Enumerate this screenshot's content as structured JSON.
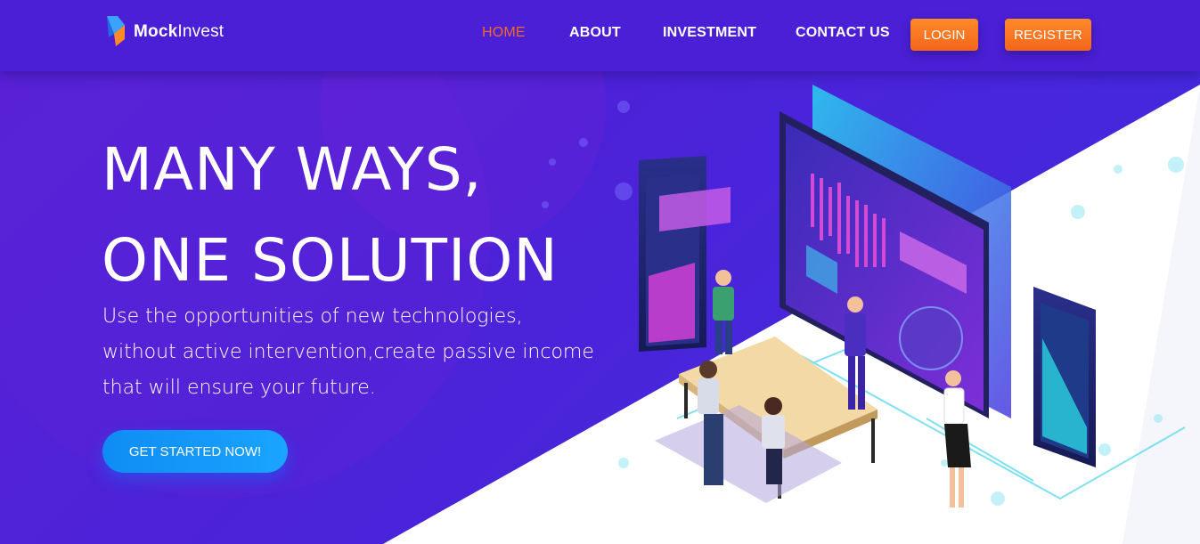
{
  "brand": {
    "name_bold": "Mock",
    "name_rest": "Invest"
  },
  "nav": {
    "items": [
      {
        "label": "HOME",
        "active": true
      },
      {
        "label": "ABOUT"
      },
      {
        "label": "INVESTMENT"
      },
      {
        "label": "CONTACT US"
      }
    ],
    "login_label": "LOGIN",
    "register_label": "REGISTER"
  },
  "hero": {
    "headline_line1": "MANY WAYS,",
    "headline_line2": "ONE SOLUTION",
    "subtext": "Use the opportunities of new technologies, without active intervention,create passive income that will ensure your future.",
    "cta_label": "GET STARTED NOW!"
  },
  "colors": {
    "nav_bg": "#4a1fd6",
    "hero_bg": "#4d22d8",
    "accent_orange": "#f2661c",
    "cta_blue": "#1a9cff",
    "active_nav": "#f06a2a"
  }
}
